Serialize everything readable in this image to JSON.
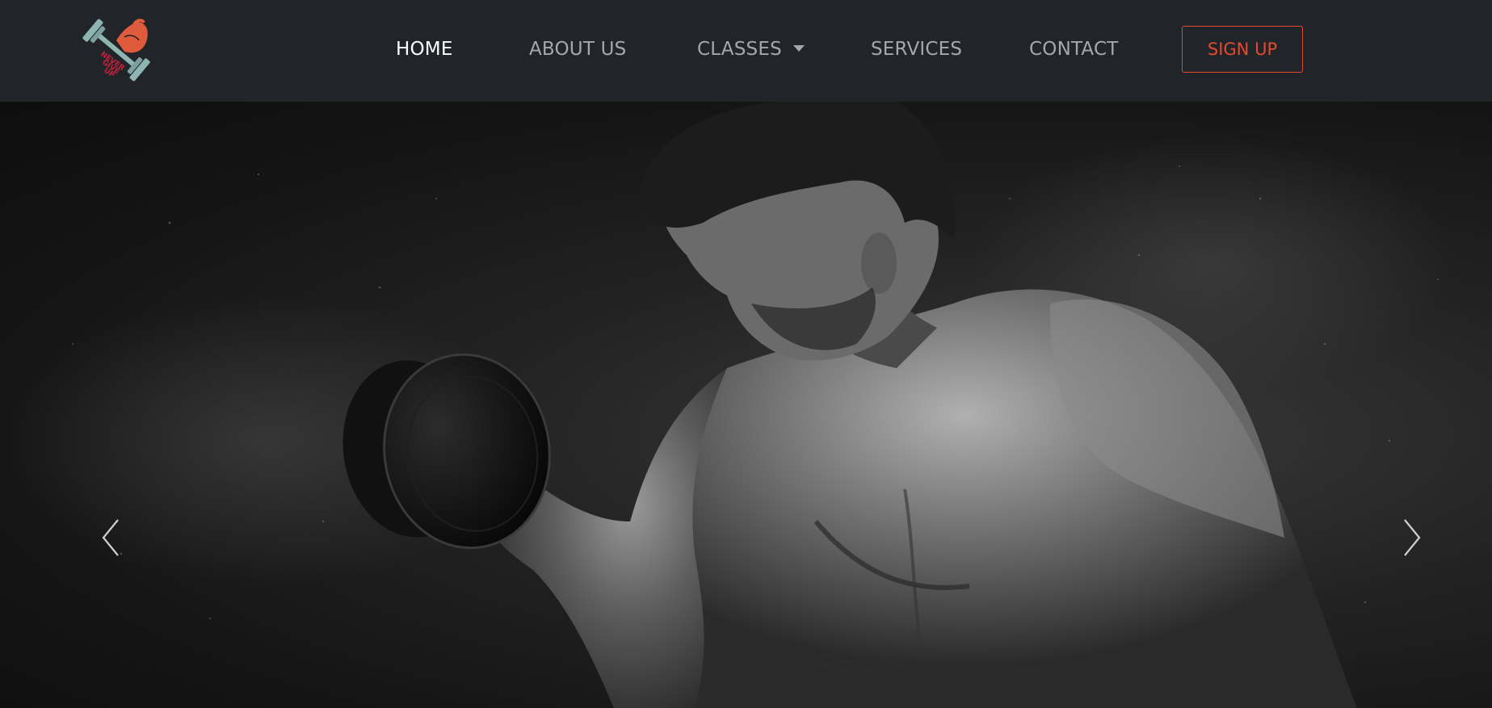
{
  "brand": {
    "logo_icon": "dumbbell-flexed-arm-logo",
    "logo_text": "NEVER GIVE UP",
    "accent_color": "#e34a2f"
  },
  "nav": {
    "items": [
      {
        "label": "HOME",
        "active": true
      },
      {
        "label": "ABOUT US",
        "active": false
      },
      {
        "label": "CLASSES",
        "active": false,
        "has_dropdown": true
      },
      {
        "label": "SERVICES",
        "active": false
      },
      {
        "label": "CONTACT",
        "active": false
      }
    ],
    "signup_label": "SIGN UP"
  },
  "hero": {
    "image": "bodybuilder-dumbbell-curl-photo",
    "prev_icon": "chevron-left-icon",
    "next_icon": "chevron-right-icon"
  }
}
